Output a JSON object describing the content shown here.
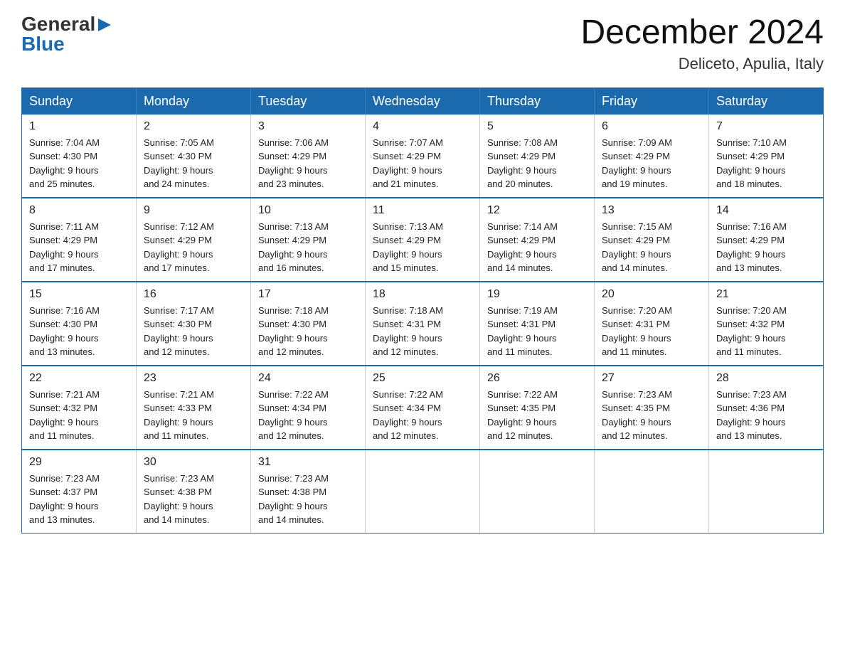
{
  "logo": {
    "general": "General",
    "blue": "Blue",
    "arrow": "▶"
  },
  "title": "December 2024",
  "subtitle": "Deliceto, Apulia, Italy",
  "days_of_week": [
    "Sunday",
    "Monday",
    "Tuesday",
    "Wednesday",
    "Thursday",
    "Friday",
    "Saturday"
  ],
  "weeks": [
    [
      {
        "day": "1",
        "sunrise": "Sunrise: 7:04 AM",
        "sunset": "Sunset: 4:30 PM",
        "daylight": "Daylight: 9 hours",
        "daylight2": "and 25 minutes."
      },
      {
        "day": "2",
        "sunrise": "Sunrise: 7:05 AM",
        "sunset": "Sunset: 4:30 PM",
        "daylight": "Daylight: 9 hours",
        "daylight2": "and 24 minutes."
      },
      {
        "day": "3",
        "sunrise": "Sunrise: 7:06 AM",
        "sunset": "Sunset: 4:29 PM",
        "daylight": "Daylight: 9 hours",
        "daylight2": "and 23 minutes."
      },
      {
        "day": "4",
        "sunrise": "Sunrise: 7:07 AM",
        "sunset": "Sunset: 4:29 PM",
        "daylight": "Daylight: 9 hours",
        "daylight2": "and 21 minutes."
      },
      {
        "day": "5",
        "sunrise": "Sunrise: 7:08 AM",
        "sunset": "Sunset: 4:29 PM",
        "daylight": "Daylight: 9 hours",
        "daylight2": "and 20 minutes."
      },
      {
        "day": "6",
        "sunrise": "Sunrise: 7:09 AM",
        "sunset": "Sunset: 4:29 PM",
        "daylight": "Daylight: 9 hours",
        "daylight2": "and 19 minutes."
      },
      {
        "day": "7",
        "sunrise": "Sunrise: 7:10 AM",
        "sunset": "Sunset: 4:29 PM",
        "daylight": "Daylight: 9 hours",
        "daylight2": "and 18 minutes."
      }
    ],
    [
      {
        "day": "8",
        "sunrise": "Sunrise: 7:11 AM",
        "sunset": "Sunset: 4:29 PM",
        "daylight": "Daylight: 9 hours",
        "daylight2": "and 17 minutes."
      },
      {
        "day": "9",
        "sunrise": "Sunrise: 7:12 AM",
        "sunset": "Sunset: 4:29 PM",
        "daylight": "Daylight: 9 hours",
        "daylight2": "and 17 minutes."
      },
      {
        "day": "10",
        "sunrise": "Sunrise: 7:13 AM",
        "sunset": "Sunset: 4:29 PM",
        "daylight": "Daylight: 9 hours",
        "daylight2": "and 16 minutes."
      },
      {
        "day": "11",
        "sunrise": "Sunrise: 7:13 AM",
        "sunset": "Sunset: 4:29 PM",
        "daylight": "Daylight: 9 hours",
        "daylight2": "and 15 minutes."
      },
      {
        "day": "12",
        "sunrise": "Sunrise: 7:14 AM",
        "sunset": "Sunset: 4:29 PM",
        "daylight": "Daylight: 9 hours",
        "daylight2": "and 14 minutes."
      },
      {
        "day": "13",
        "sunrise": "Sunrise: 7:15 AM",
        "sunset": "Sunset: 4:29 PM",
        "daylight": "Daylight: 9 hours",
        "daylight2": "and 14 minutes."
      },
      {
        "day": "14",
        "sunrise": "Sunrise: 7:16 AM",
        "sunset": "Sunset: 4:29 PM",
        "daylight": "Daylight: 9 hours",
        "daylight2": "and 13 minutes."
      }
    ],
    [
      {
        "day": "15",
        "sunrise": "Sunrise: 7:16 AM",
        "sunset": "Sunset: 4:30 PM",
        "daylight": "Daylight: 9 hours",
        "daylight2": "and 13 minutes."
      },
      {
        "day": "16",
        "sunrise": "Sunrise: 7:17 AM",
        "sunset": "Sunset: 4:30 PM",
        "daylight": "Daylight: 9 hours",
        "daylight2": "and 12 minutes."
      },
      {
        "day": "17",
        "sunrise": "Sunrise: 7:18 AM",
        "sunset": "Sunset: 4:30 PM",
        "daylight": "Daylight: 9 hours",
        "daylight2": "and 12 minutes."
      },
      {
        "day": "18",
        "sunrise": "Sunrise: 7:18 AM",
        "sunset": "Sunset: 4:31 PM",
        "daylight": "Daylight: 9 hours",
        "daylight2": "and 12 minutes."
      },
      {
        "day": "19",
        "sunrise": "Sunrise: 7:19 AM",
        "sunset": "Sunset: 4:31 PM",
        "daylight": "Daylight: 9 hours",
        "daylight2": "and 11 minutes."
      },
      {
        "day": "20",
        "sunrise": "Sunrise: 7:20 AM",
        "sunset": "Sunset: 4:31 PM",
        "daylight": "Daylight: 9 hours",
        "daylight2": "and 11 minutes."
      },
      {
        "day": "21",
        "sunrise": "Sunrise: 7:20 AM",
        "sunset": "Sunset: 4:32 PM",
        "daylight": "Daylight: 9 hours",
        "daylight2": "and 11 minutes."
      }
    ],
    [
      {
        "day": "22",
        "sunrise": "Sunrise: 7:21 AM",
        "sunset": "Sunset: 4:32 PM",
        "daylight": "Daylight: 9 hours",
        "daylight2": "and 11 minutes."
      },
      {
        "day": "23",
        "sunrise": "Sunrise: 7:21 AM",
        "sunset": "Sunset: 4:33 PM",
        "daylight": "Daylight: 9 hours",
        "daylight2": "and 11 minutes."
      },
      {
        "day": "24",
        "sunrise": "Sunrise: 7:22 AM",
        "sunset": "Sunset: 4:34 PM",
        "daylight": "Daylight: 9 hours",
        "daylight2": "and 12 minutes."
      },
      {
        "day": "25",
        "sunrise": "Sunrise: 7:22 AM",
        "sunset": "Sunset: 4:34 PM",
        "daylight": "Daylight: 9 hours",
        "daylight2": "and 12 minutes."
      },
      {
        "day": "26",
        "sunrise": "Sunrise: 7:22 AM",
        "sunset": "Sunset: 4:35 PM",
        "daylight": "Daylight: 9 hours",
        "daylight2": "and 12 minutes."
      },
      {
        "day": "27",
        "sunrise": "Sunrise: 7:23 AM",
        "sunset": "Sunset: 4:35 PM",
        "daylight": "Daylight: 9 hours",
        "daylight2": "and 12 minutes."
      },
      {
        "day": "28",
        "sunrise": "Sunrise: 7:23 AM",
        "sunset": "Sunset: 4:36 PM",
        "daylight": "Daylight: 9 hours",
        "daylight2": "and 13 minutes."
      }
    ],
    [
      {
        "day": "29",
        "sunrise": "Sunrise: 7:23 AM",
        "sunset": "Sunset: 4:37 PM",
        "daylight": "Daylight: 9 hours",
        "daylight2": "and 13 minutes."
      },
      {
        "day": "30",
        "sunrise": "Sunrise: 7:23 AM",
        "sunset": "Sunset: 4:38 PM",
        "daylight": "Daylight: 9 hours",
        "daylight2": "and 14 minutes."
      },
      {
        "day": "31",
        "sunrise": "Sunrise: 7:23 AM",
        "sunset": "Sunset: 4:38 PM",
        "daylight": "Daylight: 9 hours",
        "daylight2": "and 14 minutes."
      },
      null,
      null,
      null,
      null
    ]
  ]
}
